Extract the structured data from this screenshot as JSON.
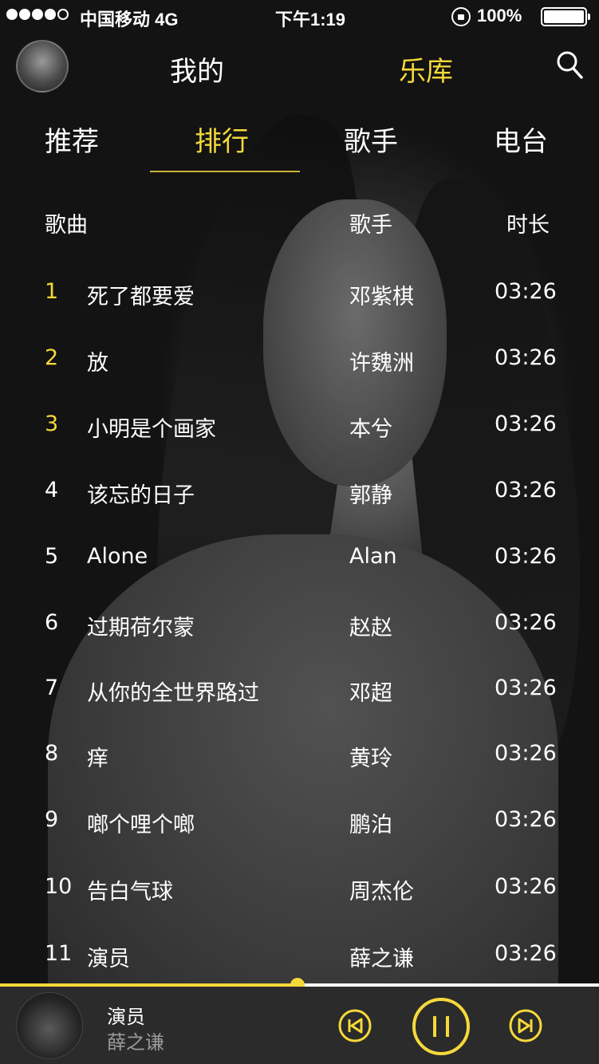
{
  "status_bar": {
    "carrier": "中国移动 4G",
    "time": "下午1:19",
    "battery": "100%"
  },
  "top_nav": {
    "mine": "我的",
    "library": "乐库"
  },
  "tabs": {
    "recommend": "推荐",
    "ranking": "排行",
    "singer": "歌手",
    "radio": "电台"
  },
  "columns": {
    "song": "歌曲",
    "artist": "歌手",
    "duration": "时长"
  },
  "songs": [
    {
      "rank": "1",
      "title": "死了都要爱",
      "artist": "邓紫棋",
      "duration": "03:26"
    },
    {
      "rank": "2",
      "title": "放",
      "artist": "许魏洲",
      "duration": "03:26"
    },
    {
      "rank": "3",
      "title": "小明是个画家",
      "artist": "本兮",
      "duration": "03:26"
    },
    {
      "rank": "4",
      "title": "该忘的日子",
      "artist": "郭静",
      "duration": "03:26"
    },
    {
      "rank": "5",
      "title": "Alone",
      "artist": "Alan",
      "duration": "03:26"
    },
    {
      "rank": "6",
      "title": "过期荷尔蒙",
      "artist": "赵赵",
      "duration": "03:26"
    },
    {
      "rank": "7",
      "title": "从你的全世界路过",
      "artist": "邓超",
      "duration": "03:26"
    },
    {
      "rank": "8",
      "title": "痒",
      "artist": "黄玲",
      "duration": "03:26"
    },
    {
      "rank": "9",
      "title": "啷个哩个啷",
      "artist": "鹏泊",
      "duration": "03:26"
    },
    {
      "rank": "10",
      "title": "告白气球",
      "artist": "周杰伦",
      "duration": "03:26"
    },
    {
      "rank": "11",
      "title": "演员",
      "artist": "薛之谦",
      "duration": "03:26"
    }
  ],
  "now_playing": {
    "title": "演员",
    "artist": "薛之谦",
    "progress": 0.497
  },
  "colors": {
    "accent": "#f5d93a"
  },
  "icons": [
    "search-icon",
    "prev-icon",
    "pause-icon",
    "next-icon",
    "lock-rotation-icon",
    "battery-icon"
  ]
}
